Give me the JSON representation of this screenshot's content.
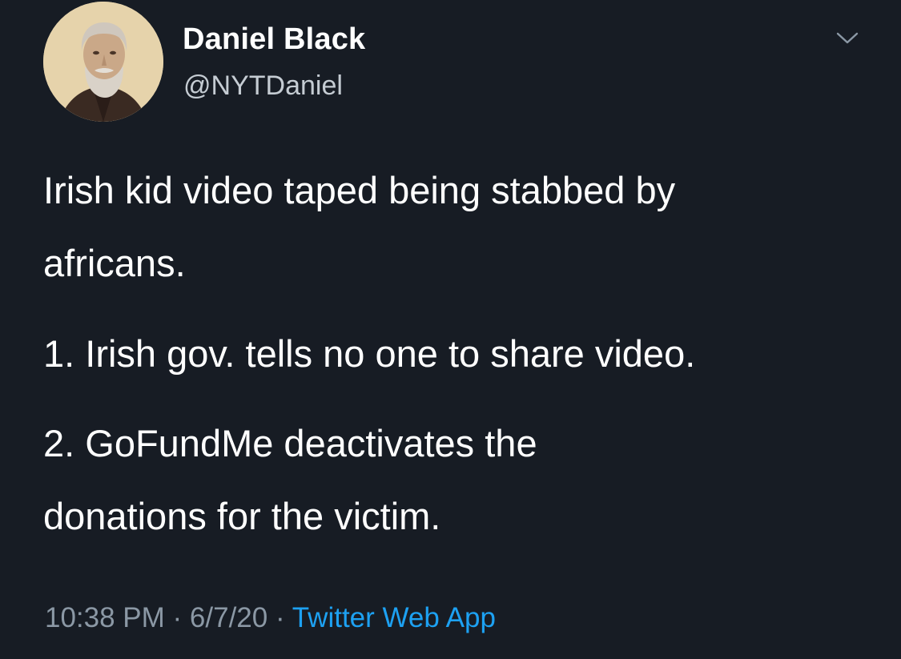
{
  "user": {
    "display_name": "Daniel Black",
    "handle": "@NYTDaniel"
  },
  "tweet": {
    "lines": [
      "Irish kid video taped being stabbed by",
      "africans.",
      "1. Irish gov. tells no one to share video.",
      "2. GoFundMe deactivates the",
      "donations for the victim."
    ]
  },
  "meta": {
    "time": "10:38 PM",
    "separator": " · ",
    "date": "6/7/20",
    "source": "Twitter Web App"
  },
  "icons": {
    "avatar": "portrait-avatar",
    "menu": "chevron-down-icon"
  },
  "colors": {
    "background": "#171c24",
    "text": "#ffffff",
    "secondary": "#8b98a5",
    "link": "#1da1f2"
  }
}
